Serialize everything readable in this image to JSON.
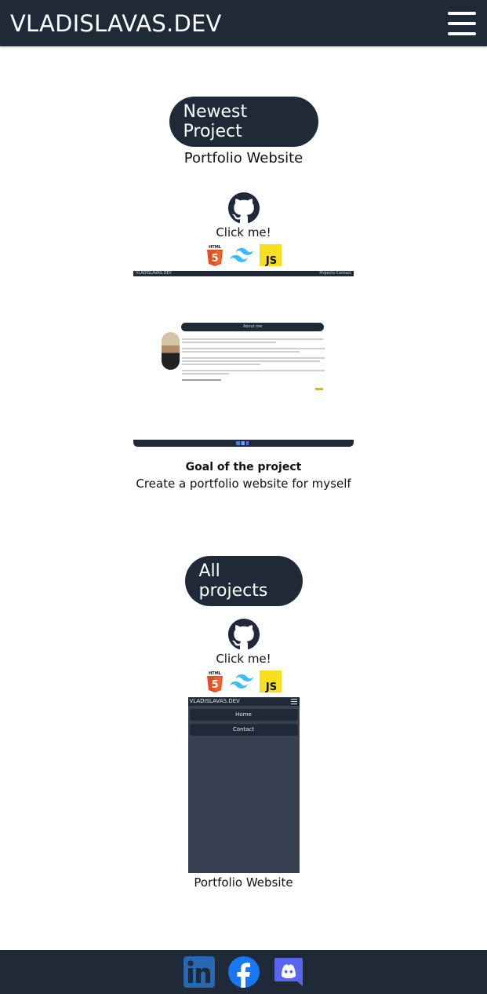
{
  "header": {
    "brand": "VLADISLAVAS.DEV",
    "menu_icon": "hamburger-menu-icon"
  },
  "newest": {
    "heading": "Newest Project",
    "title": "Portfolio Website",
    "github_icon": "github-icon",
    "link_label": "Click me!",
    "tech_icons": [
      "html5-icon",
      "tailwind-icon",
      "javascript-icon"
    ],
    "screenshot": {
      "brand": "VLADISLAVAS.DEV",
      "nav": "Projects  Contact",
      "pill": "About me"
    },
    "goal_title": "Goal of the project",
    "goal_text": "Create a portfolio website for myself"
  },
  "all": {
    "heading": "All projects",
    "github_icon": "github-icon",
    "link_label": "Click me!",
    "tech_icons": [
      "html5-icon",
      "tailwind-icon",
      "javascript-icon"
    ],
    "preview": {
      "brand": "VLADISLAVAS.DEV",
      "home": "Home",
      "contact": "Contact"
    },
    "caption": "Portfolio Website"
  },
  "footer": {
    "social_icons": [
      "linkedin-icon",
      "facebook-icon",
      "discord-icon"
    ]
  },
  "colors": {
    "navy": "#1f2937",
    "html5": "#e44d26",
    "tailwind": "#38bdf8",
    "js": "#f7df1e",
    "linkedin": "#2867b2",
    "facebook": "#1877f2",
    "discord": "#5865f2"
  }
}
